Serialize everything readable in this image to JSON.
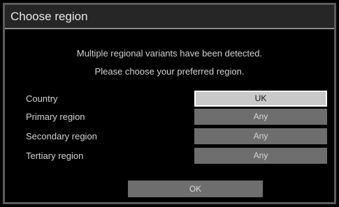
{
  "dialog": {
    "title": "Choose region",
    "message_line1": "Multiple regional variants have been detected.",
    "message_line2": "Please choose your preferred region.",
    "rows": [
      {
        "label": "Country",
        "value": "UK",
        "focused": true
      },
      {
        "label": "Primary region",
        "value": "Any",
        "focused": false
      },
      {
        "label": "Secondary region",
        "value": "Any",
        "focused": false
      },
      {
        "label": "Tertiary region",
        "value": "Any",
        "focused": false
      }
    ],
    "ok_label": "OK"
  },
  "colors": {
    "background": "#000000",
    "title_bar": "#262626",
    "border": "#5c5c5c",
    "selector": "#6e6e6e",
    "selector_focused": "#c9c9c9",
    "text": "#d2d2d2"
  }
}
